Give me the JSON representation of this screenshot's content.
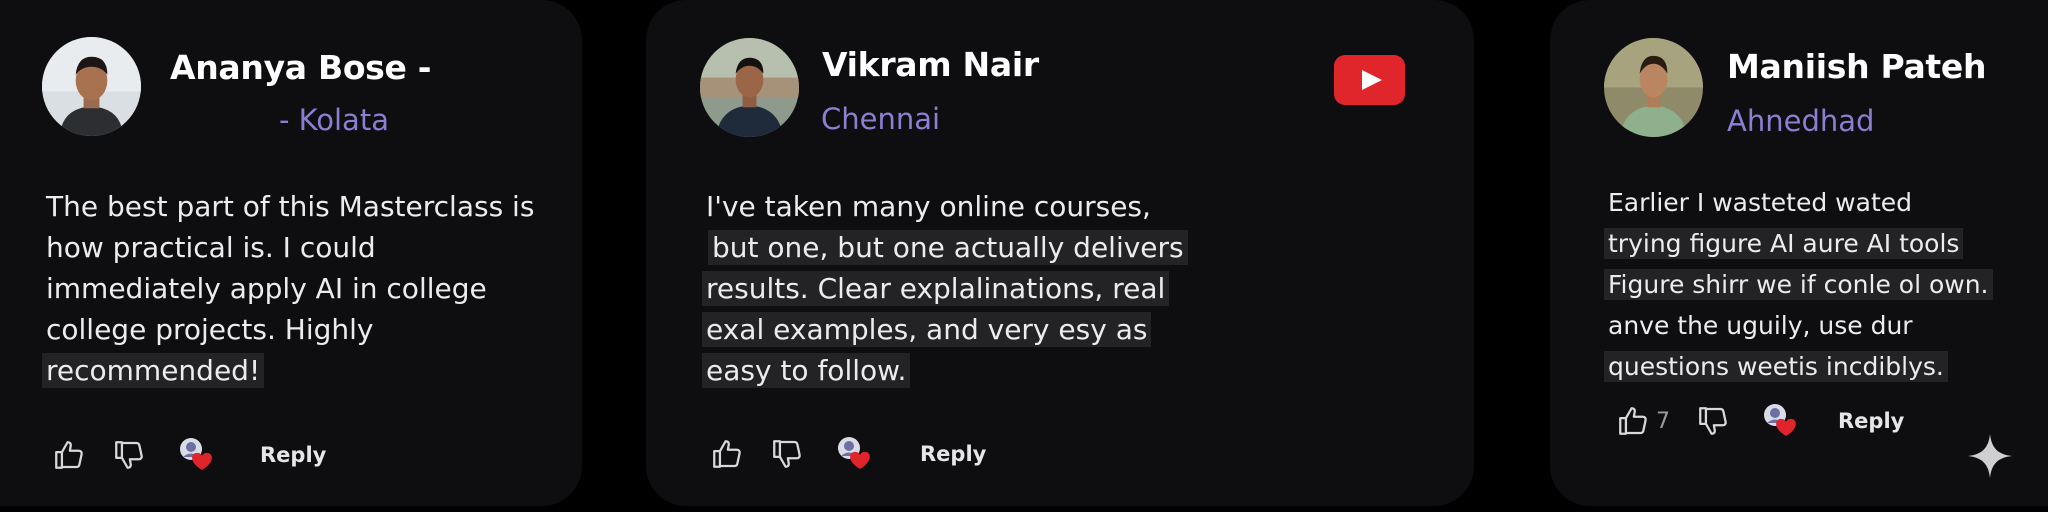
{
  "colors": {
    "background": "#000000",
    "card": "#0e0e10",
    "name": "#ffffff",
    "location": "#8a7fd1",
    "text": "#ececec",
    "highlight": "#232326",
    "heart": "#e0242b",
    "youtube": "#e0262b"
  },
  "comments": [
    {
      "name": "Ananya Bose -",
      "location": "- Kolata",
      "lines": [
        "The best part of this Masterclass is",
        "how practical is. I could",
        "immediately apply AI in college",
        "college projects. Highly",
        "recommended!"
      ],
      "reply_label": "Reply"
    },
    {
      "name": "Vikram Nair",
      "location": "Chennai",
      "lines": [
        "I've taken many online courses,",
        "but one, but one actually delivers",
        "results. Clear explalinations, real",
        "exal examples, and very esy as",
        "easy to follow."
      ],
      "reply_label": "Reply"
    },
    {
      "name": "Maniish Pateh",
      "location": "Ahnedhad",
      "lines": [
        "Earlier I wasteted wated",
        "trying figure AI aure AI tools",
        "Figure shirr we if conle ol own.",
        "anve the uguily, use dur",
        "questions weetis incdiblys."
      ],
      "like_count": "7",
      "reply_label": "Reply"
    }
  ],
  "icons": {
    "like": "thumbs-up-icon",
    "dislike": "thumbs-down-icon",
    "heart_badge": "creator-heart-icon",
    "platform": "youtube-logo-icon",
    "watermark": "sparkle-icon"
  }
}
